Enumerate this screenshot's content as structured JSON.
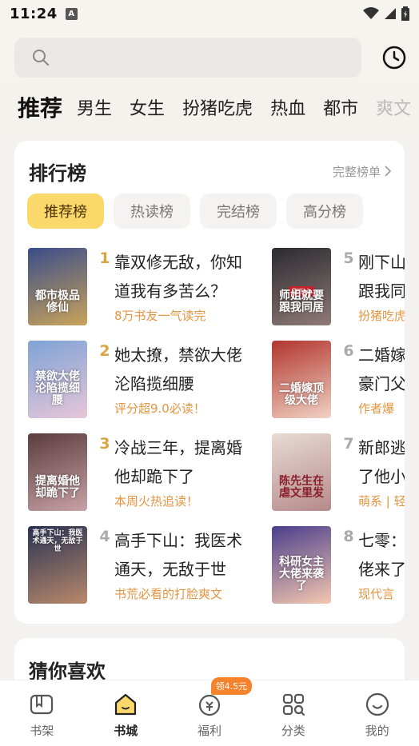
{
  "status_bar": {
    "time": "11:24",
    "indicator": "A"
  },
  "search": {
    "placeholder": ""
  },
  "categories": [
    "推荐",
    "男生",
    "女生",
    "扮猪吃虎",
    "热血",
    "都市",
    "爽文"
  ],
  "ranking": {
    "title": "排行榜",
    "more_label": "完整榜单",
    "tabs": [
      "推荐榜",
      "热读榜",
      "完结榜",
      "高分榜"
    ],
    "books": [
      {
        "rank": "1",
        "name": "靠双修无敌，你知道我有多苦么？",
        "tag": "8万书友一气读完",
        "cover_title": "都市极品修仙",
        "cover_color1": "#3a4d8a",
        "cover_color2": "#c9a35a",
        "cover_badge": ""
      },
      {
        "rank": "2",
        "name": "她太撩，禁欲大佬沦陷揽细腰",
        "tag": "评分超9.0必读！",
        "cover_title": "禁欲大佬沦陷揽细腰",
        "cover_color1": "#7ea3d6",
        "cover_color2": "#e7c6d8",
        "cover_badge": ""
      },
      {
        "rank": "3",
        "name": "冷战三年，提离婚他却跪下了",
        "tag": "本周火热追读！",
        "cover_title": "提离婚他却跪下了",
        "cover_color1": "#5b3d3e",
        "cover_color2": "#c7a1a6",
        "cover_badge": ""
      },
      {
        "rank": "4",
        "name": "高手下山：我医术通天，无敌于世",
        "tag": "书荒必看的打脸爽文",
        "cover_title": "高手下山：我医术通天，无敌于世",
        "cover_color1": "#2a3355",
        "cover_color2": "#b8896a",
        "cover_badge": ""
      },
      {
        "rank": "5",
        "name": "刚下山，师姐就要跟我同居",
        "tag": "扮猪吃虎",
        "cover_title": "师姐就要跟我同居",
        "cover_color1": "#2b2b31",
        "cover_color2": "#8f7a77",
        "cover_badge": "刚下山"
      },
      {
        "rank": "6",
        "name": "二婚嫁顶级大佬，豪门父母",
        "tag": "作者爆",
        "cover_title": "二婚嫁顶级大佬",
        "cover_color1": "#b2352f",
        "cover_color2": "#f0d2c2",
        "cover_badge": ""
      },
      {
        "rank": "7",
        "name": "新郎逃婚，我嫁给了他小叔顶上",
        "tag": "萌系 | 轻",
        "cover_title": "陈先生在虐文里发",
        "cover_color1": "#e8dbd4",
        "cover_color2": "#b58a8a",
        "cover_badge": ""
      },
      {
        "rank": "8",
        "name": "七零：科研女主大佬来了，冷面大",
        "tag": "现代言",
        "cover_title": "科研女主大佬来袭了",
        "cover_color1": "#4b3f8c",
        "cover_color2": "#f4c7b0",
        "cover_badge": ""
      }
    ]
  },
  "guess": {
    "title": "猜你喜欢"
  },
  "bottom_nav": [
    {
      "label": "书架",
      "icon": "bookshelf-icon"
    },
    {
      "label": "书城",
      "icon": "bookstore-icon"
    },
    {
      "label": "福利",
      "icon": "welfare-icon",
      "badge": "领4.5元"
    },
    {
      "label": "分类",
      "icon": "category-icon"
    },
    {
      "label": "我的",
      "icon": "profile-icon"
    }
  ],
  "colors": {
    "accent": "#fbd86a",
    "tag": "#e49542",
    "rank_top": "#d9a441",
    "badge": "#f5832c"
  }
}
